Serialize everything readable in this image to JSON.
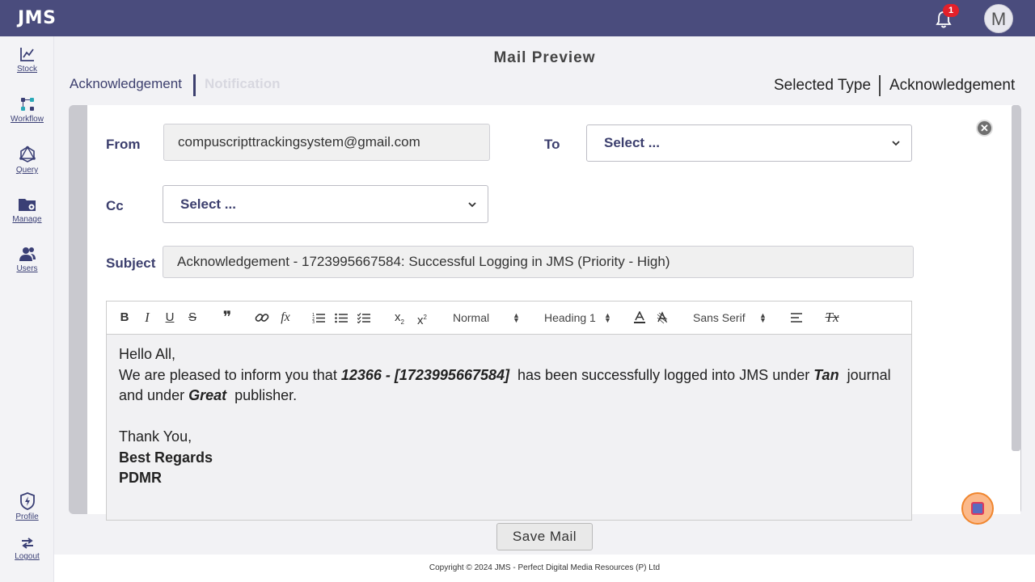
{
  "app": {
    "logo": "JMS",
    "notification_count": "1",
    "avatar_initial": "M"
  },
  "sidebar": {
    "items": [
      {
        "label": "Stock",
        "icon": "chart-line-icon"
      },
      {
        "label": "Workflow",
        "icon": "workflow-icon"
      },
      {
        "label": "Query",
        "icon": "query-graph-icon"
      },
      {
        "label": "Manage",
        "icon": "folder-settings-icon"
      },
      {
        "label": "Users",
        "icon": "users-icon"
      },
      {
        "label": "Profile",
        "icon": "shield-bolt-icon"
      },
      {
        "label": "Logout",
        "icon": "logout-arrows-icon"
      }
    ]
  },
  "page": {
    "title": "Mail Preview",
    "tabs": [
      "Acknowledgement",
      "Notification"
    ],
    "selected_type_label": "Selected Type",
    "selected_type_value": "Acknowledgement"
  },
  "form": {
    "from_label": "From",
    "from_value": "compuscripttrackingsystem@gmail.com",
    "to_label": "To",
    "to_placeholder": "Select ...",
    "cc_label": "Cc",
    "cc_placeholder": "Select ...",
    "subject_label": "Subject",
    "subject_value": "Acknowledgement - 1723995667584: Successful Logging in JMS (Priority - High)"
  },
  "toolbar": {
    "bold": "B",
    "italic": "I",
    "underline": "U",
    "strike": "S",
    "quote": "❞",
    "formula": "fx",
    "size_select": "Normal",
    "header_select": "Heading 1",
    "font_select": "Sans Serif",
    "clear": "Tx"
  },
  "editor": {
    "greeting": "Hello All,",
    "line1_pre": "We are pleased to inform you that ",
    "article": "12366 - [1723995667584]",
    "line1_mid": "  has been successfully logged into JMS under ",
    "journal": "Tan",
    "line1_post": "  journal and under ",
    "publisher": "Great",
    "line1_end": "  publisher.",
    "thanks": "Thank You,",
    "regards": "Best Regards",
    "signature": "PDMR"
  },
  "actions": {
    "save_label": "Save Mail"
  },
  "footer": {
    "copyright": "Copyright © 2024 JMS - Perfect Digital Media Resources (P) Ltd"
  },
  "colors": {
    "topbar": "#4a4c7d",
    "accent": "#3c3f6e",
    "badge": "#e4202a"
  }
}
